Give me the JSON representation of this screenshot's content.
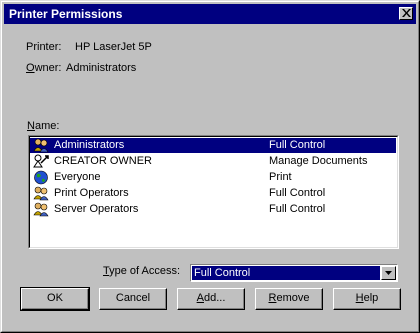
{
  "window": {
    "title": "Printer Permissions"
  },
  "info": {
    "printer_label": "Printer:",
    "printer_value": "HP LaserJet 5P",
    "owner_label_accel": "O",
    "owner_label_rest": "wner:",
    "owner_value": "Administrators"
  },
  "names": {
    "label_accel": "N",
    "label_rest": "ame:",
    "rows": [
      {
        "name": "Administrators",
        "permission": "Full Control",
        "icon": "group-icon",
        "selected": true
      },
      {
        "name": "CREATOR OWNER",
        "permission": "Manage Documents",
        "icon": "creator-owner-icon",
        "selected": false
      },
      {
        "name": "Everyone",
        "permission": "Print",
        "icon": "globe-icon",
        "selected": false
      },
      {
        "name": "Print Operators",
        "permission": "Full Control",
        "icon": "group-icon",
        "selected": false
      },
      {
        "name": "Server Operators",
        "permission": "Full Control",
        "icon": "group-icon",
        "selected": false
      }
    ]
  },
  "access": {
    "label_accel": "T",
    "label_rest": "ype of Access:",
    "value": "Full Control"
  },
  "buttons": {
    "ok": "OK",
    "cancel": "Cancel",
    "add_accel": "A",
    "add_rest": "dd...",
    "remove_accel": "R",
    "remove_rest": "emove",
    "help_accel": "H",
    "help_rest": "elp"
  },
  "colors": {
    "titlebar": "#000080",
    "face": "#c0c0c0",
    "selection": "#000080"
  }
}
